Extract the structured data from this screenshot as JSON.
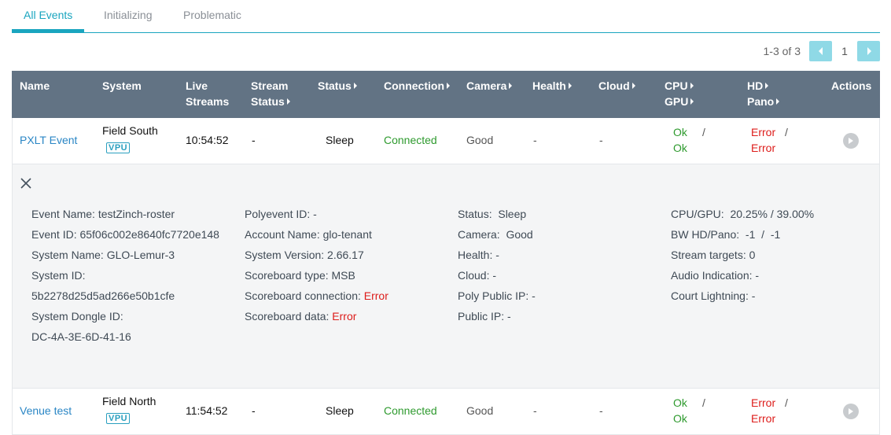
{
  "tabs": [
    {
      "label": "All Events"
    },
    {
      "label": "Initializing"
    },
    {
      "label": "Problematic"
    }
  ],
  "pager": {
    "info": "1-3 of 3",
    "page": "1"
  },
  "columns": {
    "name": "Name",
    "system": "System",
    "live_streams_1": "Live",
    "live_streams_2": "Streams",
    "stream_status_1": "Stream",
    "stream_status_2": "Status",
    "status": "Status",
    "connection": "Connection",
    "camera": "Camera",
    "health": "Health",
    "cloud": "Cloud",
    "cpu": "CPU",
    "gpu": "GPU",
    "hd": "HD",
    "pano": "Pano",
    "actions": "Actions"
  },
  "rows": [
    {
      "name": "PXLT Event",
      "system": "Field South",
      "badge": "VPU",
      "live_streams": "10:54:52",
      "stream_status": "-",
      "status": "Sleep",
      "connection": "Connected",
      "camera": "Good",
      "health": "-",
      "cloud": "-",
      "cpu": "Ok",
      "gpu": "Ok",
      "hd": "Error",
      "pano": "Error",
      "sep": "/"
    },
    {
      "name": "Venue test",
      "system": "Field North",
      "badge": "VPU",
      "live_streams": "11:54:52",
      "stream_status": "-",
      "status": "Sleep",
      "connection": "Connected",
      "camera": "Good",
      "health": "-",
      "cloud": "-",
      "cpu": "Ok",
      "gpu": "Ok",
      "hd": "Error",
      "pano": "Error",
      "sep": "/"
    }
  ],
  "details": {
    "col1": [
      "Event Name: testZinch-roster",
      "Event ID: 65f06c002e8640fc7720e148",
      "System Name: GLO-Lemur-3",
      "System ID:",
      "5b2278d25d5ad266e50b1cfe",
      "System Dongle ID:",
      "DC-4A-3E-6D-41-16"
    ],
    "col2": [
      "Polyevent ID: -",
      "Account Name: glo-tenant",
      "System Version: 2.66.17",
      "Scoreboard type: MSB"
    ],
    "scoreboard_connection_label": "Scoreboard connection:",
    "scoreboard_connection_value": "Error",
    "scoreboard_data_label": "Scoreboard data:",
    "scoreboard_data_value": "Error",
    "col3": [
      "Status:  Sleep",
      "Camera:  Good",
      "Health: -",
      "Cloud: -",
      "Poly Public IP: -",
      "Public IP: -"
    ],
    "col4": [
      "CPU/GPU:  20.25% / 39.00%",
      "BW HD/Pano:  -1  /  -1",
      "Stream targets: 0",
      "Audio Indication: -",
      "Court Lightning: -"
    ]
  },
  "colors": {
    "accent": "#1aa5bf",
    "header_bg": "#627384",
    "ok": "#2e9a2e",
    "error": "#dd1c1a",
    "link": "#2a86c5"
  },
  "icons": {
    "prev": "chevron-left-icon",
    "next": "chevron-right-icon",
    "close": "close-icon",
    "play": "play-icon",
    "sort": "sort-triangle-icon"
  }
}
